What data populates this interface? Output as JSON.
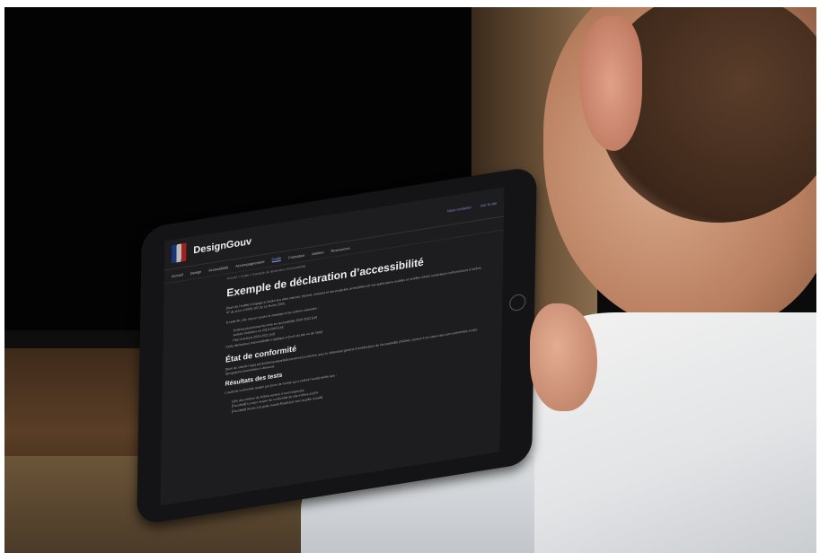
{
  "screen": {
    "brand": "DesignGouv",
    "header_links": [
      "Nous contacter",
      "Voir le site"
    ],
    "nav": [
      "Accueil",
      "Design",
      "Accessibilité",
      "Accompagnement",
      "Guide",
      "Formation",
      "Ateliers",
      "Ressources"
    ],
    "nav_active_index": 4,
    "breadcrumb": "Accueil > Guide > Exemple de déclaration d’accessibilité",
    "title": "Exemple de déclaration d’accessibilité",
    "intro": "[Nom de l’entité] s’engage à rendre ses sites internet, intranet, extranet et ses progiciels accessibles (et ses applications mobiles et mobilier urbain numérique) conformément à l’article 47 de la loi n°2005-102 du 11 février 2005.",
    "plan_intro": "À cette fin, elle met en œuvre la stratégie et les actions suivantes :",
    "plan_items": [
      "Schéma pluriannuel de mise en accessibilité 2020-2022 [url]",
      "Actions réalisées en 2019-2020 [url]",
      "Plan d’actions 2020-2021 [url]"
    ],
    "plan_outro": "Cette déclaration d’accessibilité s’applique à [nom du site ou de l’app]",
    "h2": "État de conformité",
    "conformity": "[Nom du site/de l’app] est [totalement/partiellement/non] conforme avec le référentiel général d’amélioration de l’accessibilité (RGAA), version 4 en raison des non-conformités et des dérogations énumérées ci-dessous.",
    "h3": "Résultats des tests",
    "tests_intro": "L’audit de conformité réalisé par [nom de l’entité qui a réalisé l’audit] révèle que :",
    "tests_items": [
      "[x]% des critères du RGAA version 4 sont respectés",
      "[Facultatif] Le taux moyen de conformité du site s’élève à [x]%",
      "[Facultatif] Accès à la grille d’audit RGAA [url vers la grille d’audit]"
    ]
  }
}
